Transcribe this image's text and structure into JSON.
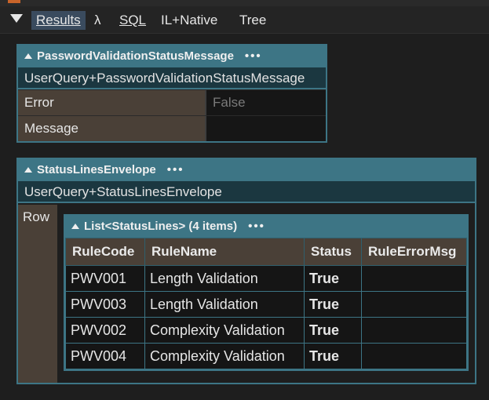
{
  "toolbar": {
    "tabs": [
      {
        "label": "Results"
      },
      {
        "label": "λ"
      },
      {
        "label": "SQL"
      },
      {
        "label": "IL+Native"
      },
      {
        "label": "Tree"
      }
    ]
  },
  "password_box": {
    "title": "PasswordValidationStatusMessage",
    "more": "•••",
    "type_name": "UserQuery+PasswordValidationStatusMessage",
    "fields": [
      {
        "key": "Error",
        "value": "False"
      },
      {
        "key": "Message",
        "value": ""
      }
    ]
  },
  "envelope_box": {
    "title": "StatusLinesEnvelope",
    "more": "•••",
    "type_name": "UserQuery+StatusLinesEnvelope",
    "row_label": "Row",
    "list": {
      "title": "List<StatusLines> (4 items)",
      "more": "•••",
      "columns": [
        "RuleCode",
        "RuleName",
        "Status",
        "RuleErrorMsg"
      ],
      "rows": [
        [
          "PWV001",
          "Length Validation",
          "True",
          ""
        ],
        [
          "PWV003",
          "Length Validation",
          "True",
          ""
        ],
        [
          "PWV002",
          "Complexity Validation",
          "True",
          ""
        ],
        [
          "PWV004",
          "Complexity Validation",
          "True",
          ""
        ]
      ]
    }
  },
  "colors": {
    "header_teal": "#3d7585",
    "key_brown": "#4a4037",
    "background": "#1e1e1e"
  }
}
